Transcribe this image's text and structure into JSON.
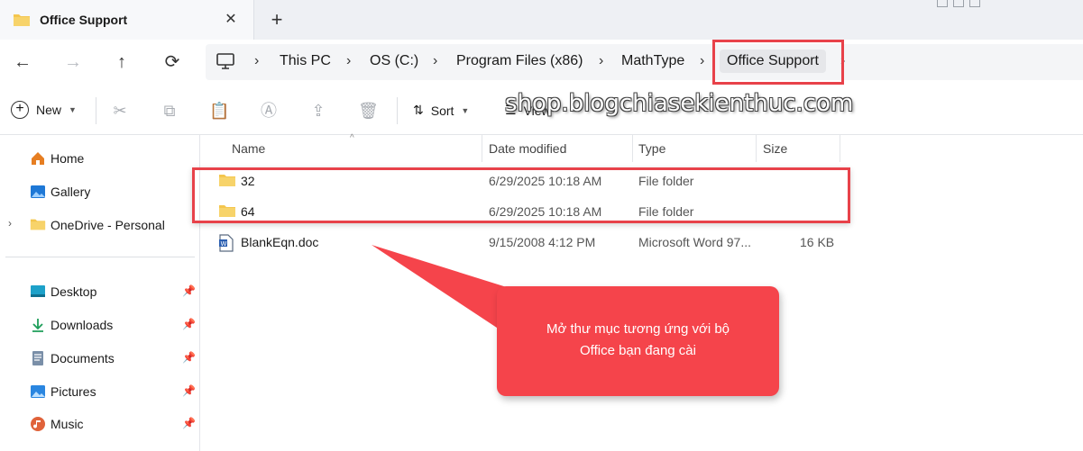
{
  "tab": {
    "title": "Office Support",
    "close": "✕",
    "new": "+"
  },
  "nav": {
    "back": "←",
    "forward": "→",
    "up": "↑",
    "refresh": "⟳"
  },
  "breadcrumb": [
    "This PC",
    "OS (C:)",
    "Program Files (x86)",
    "MathType",
    "Office Support"
  ],
  "breadcrumb_sep": "›",
  "toolbar": {
    "new_label": "New",
    "sort_label": "Sort",
    "view_label": "View"
  },
  "sidebar": {
    "top": [
      {
        "label": "Home",
        "icon": "home-icon"
      },
      {
        "label": "Gallery",
        "icon": "gallery-icon"
      },
      {
        "label": "OneDrive - Personal",
        "icon": "folder-icon"
      }
    ],
    "pinned": [
      {
        "label": "Desktop",
        "icon": "desktop-icon"
      },
      {
        "label": "Downloads",
        "icon": "download-icon"
      },
      {
        "label": "Documents",
        "icon": "document-icon"
      },
      {
        "label": "Pictures",
        "icon": "picture-icon"
      },
      {
        "label": "Music",
        "icon": "music-icon"
      }
    ]
  },
  "columns": {
    "name": "Name",
    "date": "Date modified",
    "type": "Type",
    "size": "Size"
  },
  "files": [
    {
      "name": "32",
      "date": "6/29/2025 10:18 AM",
      "type": "File folder",
      "size": "",
      "icon": "folder-icon"
    },
    {
      "name": "64",
      "date": "6/29/2025 10:18 AM",
      "type": "File folder",
      "size": "",
      "icon": "folder-icon"
    },
    {
      "name": "BlankEqn.doc",
      "date": "9/15/2008 4:12 PM",
      "type": "Microsoft Word 97...",
      "size": "16 KB",
      "icon": "word-doc-icon"
    }
  ],
  "callout": {
    "line1": "Mở thư mục tương ứng với bộ",
    "line2": "Office bạn đang cài"
  },
  "watermark": "shop.blogchiasekienthuc.com",
  "colors": {
    "accent": "#e8424a",
    "callout": "#f5444b",
    "folder": "#f4c64e"
  }
}
